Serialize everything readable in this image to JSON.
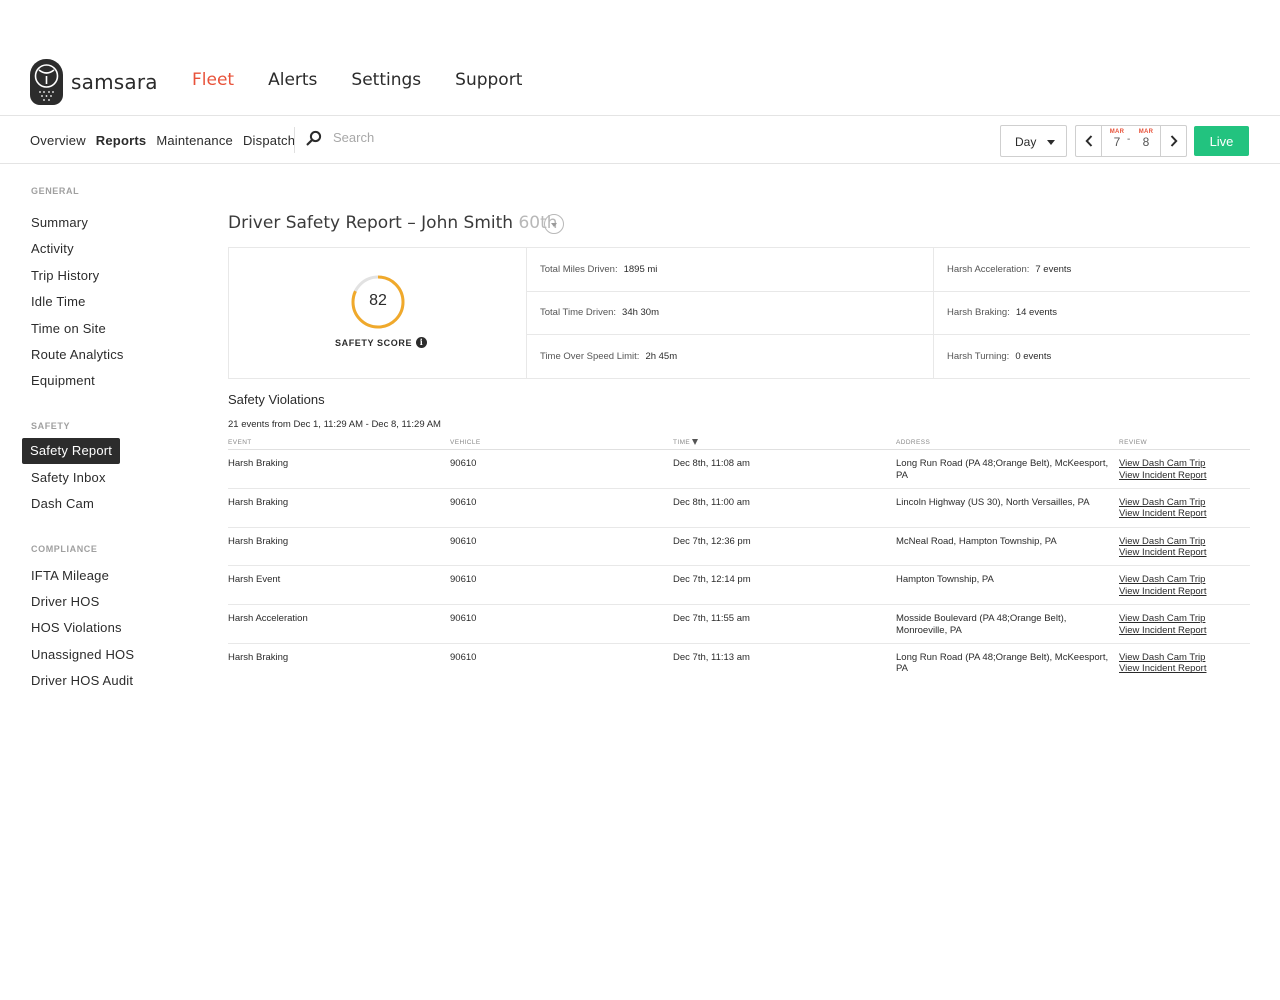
{
  "brand": {
    "name": "samsara"
  },
  "topnav": [
    {
      "label": "Fleet",
      "active": true
    },
    {
      "label": "Alerts",
      "active": false
    },
    {
      "label": "Settings",
      "active": false
    },
    {
      "label": "Support",
      "active": false
    }
  ],
  "subnav": [
    {
      "label": "Overview",
      "active": false
    },
    {
      "label": "Reports",
      "active": true
    },
    {
      "label": "Maintenance",
      "active": false
    },
    {
      "label": "Dispatch",
      "active": false
    }
  ],
  "search": {
    "placeholder": "Search",
    "value": ""
  },
  "period": {
    "selected": "Day"
  },
  "date_range": {
    "start_month": "MAR",
    "start_day": "7",
    "separator": "-",
    "end_month": "MAR",
    "end_day": "8"
  },
  "live_label": "Live",
  "colors": {
    "accent": "#e8523a",
    "live": "#22c37f",
    "score_ring": "#f0a92b"
  },
  "sidebar": {
    "general": {
      "heading": "GENERAL",
      "items": [
        "Summary",
        "Activity",
        "Trip History",
        "Idle Time",
        "Time on Site",
        "Route Analytics",
        "Equipment"
      ]
    },
    "safety": {
      "heading": "SAFETY",
      "items": [
        "Safety Report",
        "Safety Inbox",
        "Dash Cam"
      ],
      "active": "Safety Report"
    },
    "compliance": {
      "heading": "COMPLIANCE",
      "items": [
        "IFTA Mileage",
        "Driver HOS",
        "HOS Violations",
        "Unassigned HOS",
        "Driver HOS Audit"
      ]
    }
  },
  "report": {
    "title": "Driver Safety Report – John Smith",
    "rank": "60th",
    "score": {
      "value": "82",
      "label": "SAFETY SCORE",
      "fraction": 0.82
    },
    "stats": {
      "miles": {
        "label": "Total Miles Driven:",
        "value": "1895 mi"
      },
      "time": {
        "label": "Total Time Driven:",
        "value": "34h 30m"
      },
      "speed": {
        "label": "Time Over Speed Limit:",
        "value": "2h 45m"
      },
      "accel": {
        "label": "Harsh Acceleration:",
        "value": "7 events"
      },
      "braking": {
        "label": "Harsh Braking:",
        "value": "14 events"
      },
      "turning": {
        "label": "Harsh Turning:",
        "value": "0 events"
      }
    }
  },
  "violations": {
    "title": "Safety Violations",
    "subtitle": "21 events from Dec 1, 11:29 AM - Dec 8, 11:29 AM",
    "columns": {
      "event": "EVENT",
      "vehicle": "VEHICLE",
      "time": "TIME",
      "address": "ADDRESS",
      "review": "REVIEW"
    },
    "review_links": {
      "dashcam": "View Dash Cam Trip",
      "incident": "View Incident Report"
    },
    "rows": [
      {
        "event": "Harsh Braking",
        "vehicle": "90610",
        "time": "Dec 8th, 11:08 am",
        "address": "Long Run Road (PA 48;Orange Belt), McKeesport, PA"
      },
      {
        "event": "Harsh Braking",
        "vehicle": "90610",
        "time": "Dec 8th, 11:00 am",
        "address": "Lincoln Highway (US 30), North Versailles, PA"
      },
      {
        "event": "Harsh Braking",
        "vehicle": "90610",
        "time": "Dec 7th, 12:36 pm",
        "address": "McNeal Road, Hampton Township, PA"
      },
      {
        "event": "Harsh Event",
        "vehicle": "90610",
        "time": "Dec 7th, 12:14 pm",
        "address": "Hampton Township, PA"
      },
      {
        "event": "Harsh Acceleration",
        "vehicle": "90610",
        "time": "Dec 7th, 11:55 am",
        "address": "Mosside Boulevard (PA 48;Orange Belt), Monroeville, PA"
      },
      {
        "event": "Harsh Braking",
        "vehicle": "90610",
        "time": "Dec 7th, 11:13 am",
        "address": "Long Run Road (PA 48;Orange Belt), McKeesport, PA"
      }
    ]
  }
}
